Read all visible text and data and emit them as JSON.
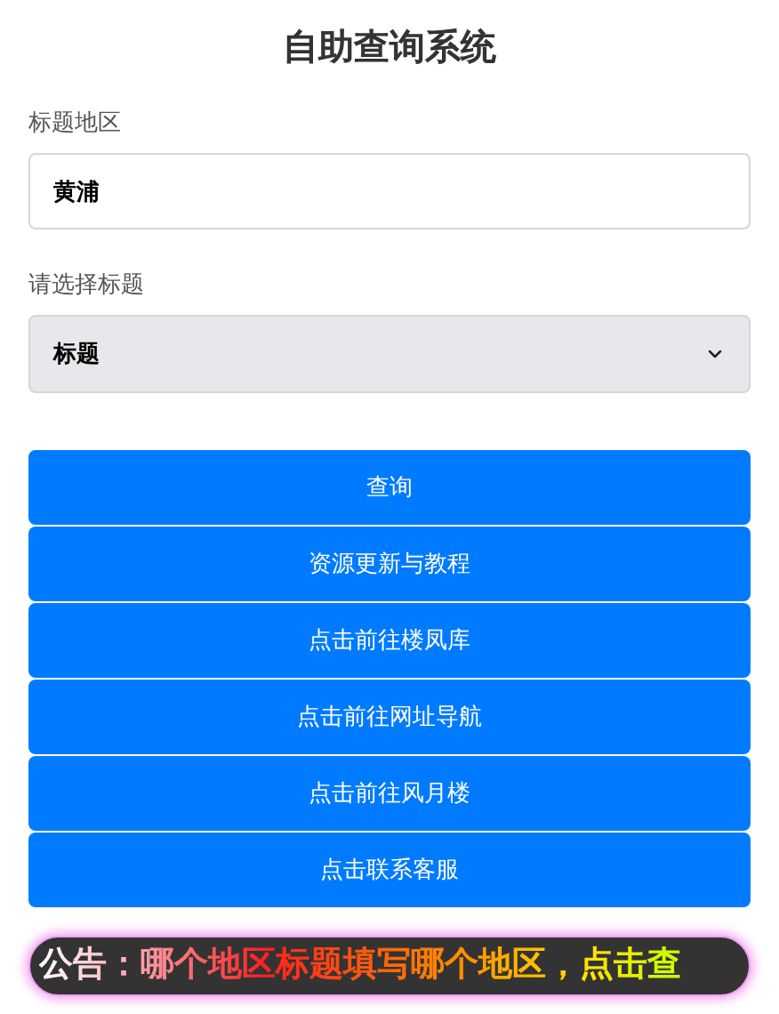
{
  "title": "自助查询系统",
  "region_field": {
    "label": "标题地区",
    "value": "黄浦"
  },
  "title_select": {
    "label": "请选择标题",
    "value": "标题"
  },
  "buttons": [
    {
      "label": "查询"
    },
    {
      "label": "资源更新与教程"
    },
    {
      "label": "点击前往楼凤库"
    },
    {
      "label": "点击前往网址导航"
    },
    {
      "label": "点击前往风月楼"
    },
    {
      "label": "点击联系客服"
    }
  ],
  "notice": "公告：哪个地区标题填写哪个地区，点击查"
}
